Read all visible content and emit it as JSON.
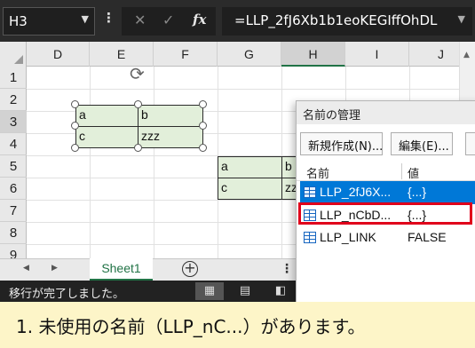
{
  "formula_bar": {
    "name_box": "H3",
    "name_box_dropdown_icon": "chevron-down-icon",
    "options_icon": "vertical-dots-icon",
    "cancel_icon": "x-icon",
    "enter_icon": "check-icon",
    "fx_label": "fx",
    "formula": "=LLP_2fJ6Xb1b1eoKEGIffOhDL"
  },
  "grid": {
    "columns": [
      "D",
      "E",
      "F",
      "G",
      "H",
      "I",
      "J"
    ],
    "selected_column": "H",
    "rows": [
      "1",
      "2",
      "3",
      "4",
      "5",
      "6",
      "7",
      "8",
      "9"
    ],
    "selected_row": "3",
    "shape_table": {
      "cells": [
        [
          "a",
          "b"
        ],
        [
          "c",
          "zzz"
        ]
      ]
    },
    "cell_table": {
      "cells": [
        [
          "a",
          "b"
        ],
        [
          "c",
          "zz"
        ]
      ]
    }
  },
  "sheet_tabs": {
    "active": "Sheet1",
    "add_icon": "plus-circle-icon"
  },
  "status_bar": {
    "message": "移行が完了しました。",
    "views": [
      "normal-view-icon",
      "page-layout-icon",
      "page-break-icon"
    ]
  },
  "dialog": {
    "title": "名前の管理",
    "buttons": [
      "新規作成(N)...",
      "編集(E)..."
    ],
    "columns": [
      "名前",
      "値"
    ],
    "rows": [
      {
        "name": "LLP_2fJ6X...",
        "value": "{...}",
        "selected": true
      },
      {
        "name": "LLP_nCbD...",
        "value": "{...}",
        "selected": false
      },
      {
        "name": "LLP_LINK",
        "value": "FALSE",
        "selected": false
      }
    ]
  },
  "caption": "1. 未使用の名前（LLP_nC...）があります。",
  "colors": {
    "excel_green": "#217346",
    "selection_blue": "#0078d7",
    "highlight_red": "#e0001b",
    "cell_fill": "#e2efda",
    "caption_bg": "#fdf5c8"
  }
}
